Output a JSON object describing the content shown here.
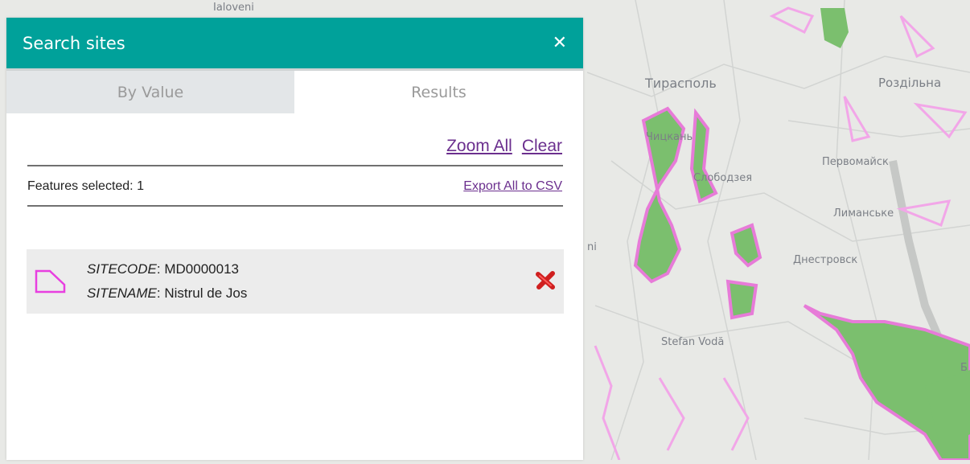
{
  "map": {
    "labels": [
      {
        "text": "Ialoveni"
      },
      {
        "text": "Тирасполь"
      },
      {
        "text": "Роздільна"
      },
      {
        "text": "Чицкань"
      },
      {
        "text": "Первомайск"
      },
      {
        "text": "Слободзея"
      },
      {
        "text": "Лиманське"
      },
      {
        "text": "Днестровск"
      },
      {
        "text": "ni"
      },
      {
        "text": "Stefan Vodă"
      },
      {
        "text": "Б"
      }
    ]
  },
  "panel": {
    "title": "Search sites",
    "close_icon": "close-icon",
    "accent_color": "#00a19a",
    "tabs": [
      {
        "label": "By Value",
        "active": false
      },
      {
        "label": "Results",
        "active": true
      }
    ],
    "actions": {
      "zoom_all": "Zoom All",
      "clear": "Clear"
    },
    "features_selected": "Features selected: 1",
    "export_label": "Export All to CSV",
    "results": [
      {
        "code_label": "SITECODE",
        "code_value": ": MD0000013",
        "name_label": "SITENAME",
        "name_value": ": Nistrul de Jos",
        "icon": "polygon-icon",
        "remove_icon": "remove-icon"
      }
    ]
  }
}
